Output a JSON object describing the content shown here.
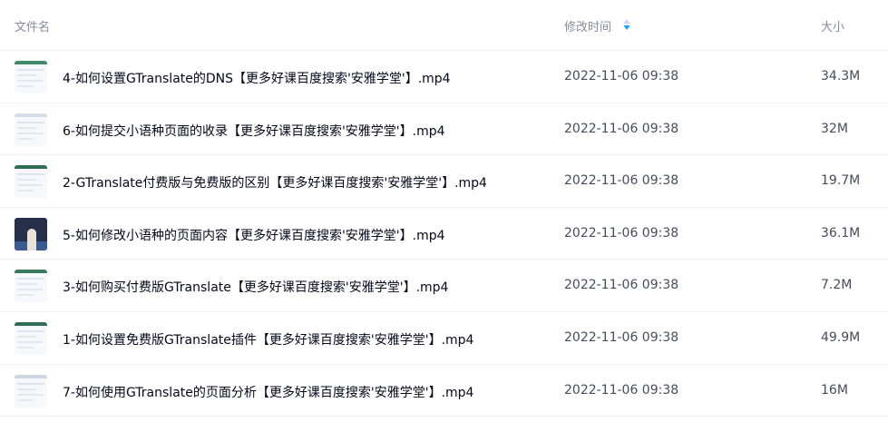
{
  "header": {
    "name_label": "文件名",
    "time_label": "修改时间",
    "size_label": "大小"
  },
  "colors": {
    "sort_active": "#06a7ff",
    "sort_inactive": "#c5d8ff"
  },
  "files": [
    {
      "name": "4-如何设置GTranslate的DNS【更多好课百度搜索'安雅学堂'】.mp4",
      "time": "2022-11-06 09:38",
      "size": "34.3M",
      "thumb": "doc"
    },
    {
      "name": "6-如何提交小语种页面的收录【更多好课百度搜索'安雅学堂'】.mp4",
      "time": "2022-11-06 09:38",
      "size": "32M",
      "thumb": "doc"
    },
    {
      "name": "2-GTranslate付费版与免费版的区别【更多好课百度搜索'安雅学堂'】.mp4",
      "time": "2022-11-06 09:38",
      "size": "19.7M",
      "thumb": "doc"
    },
    {
      "name": "5-如何修改小语种的页面内容【更多好课百度搜索'安雅学堂'】.mp4",
      "time": "2022-11-06 09:38",
      "size": "36.1M",
      "thumb": "video"
    },
    {
      "name": "3-如何购买付费版GTranslate【更多好课百度搜索'安雅学堂'】.mp4",
      "time": "2022-11-06 09:38",
      "size": "7.2M",
      "thumb": "doc"
    },
    {
      "name": "1-如何设置免费版GTranslate插件【更多好课百度搜索'安雅学堂'】.mp4",
      "time": "2022-11-06 09:38",
      "size": "49.9M",
      "thumb": "doc"
    },
    {
      "name": "7-如何使用GTranslate的页面分析【更多好课百度搜索'安雅学堂'】.mp4",
      "time": "2022-11-06 09:38",
      "size": "16M",
      "thumb": "doc"
    }
  ]
}
